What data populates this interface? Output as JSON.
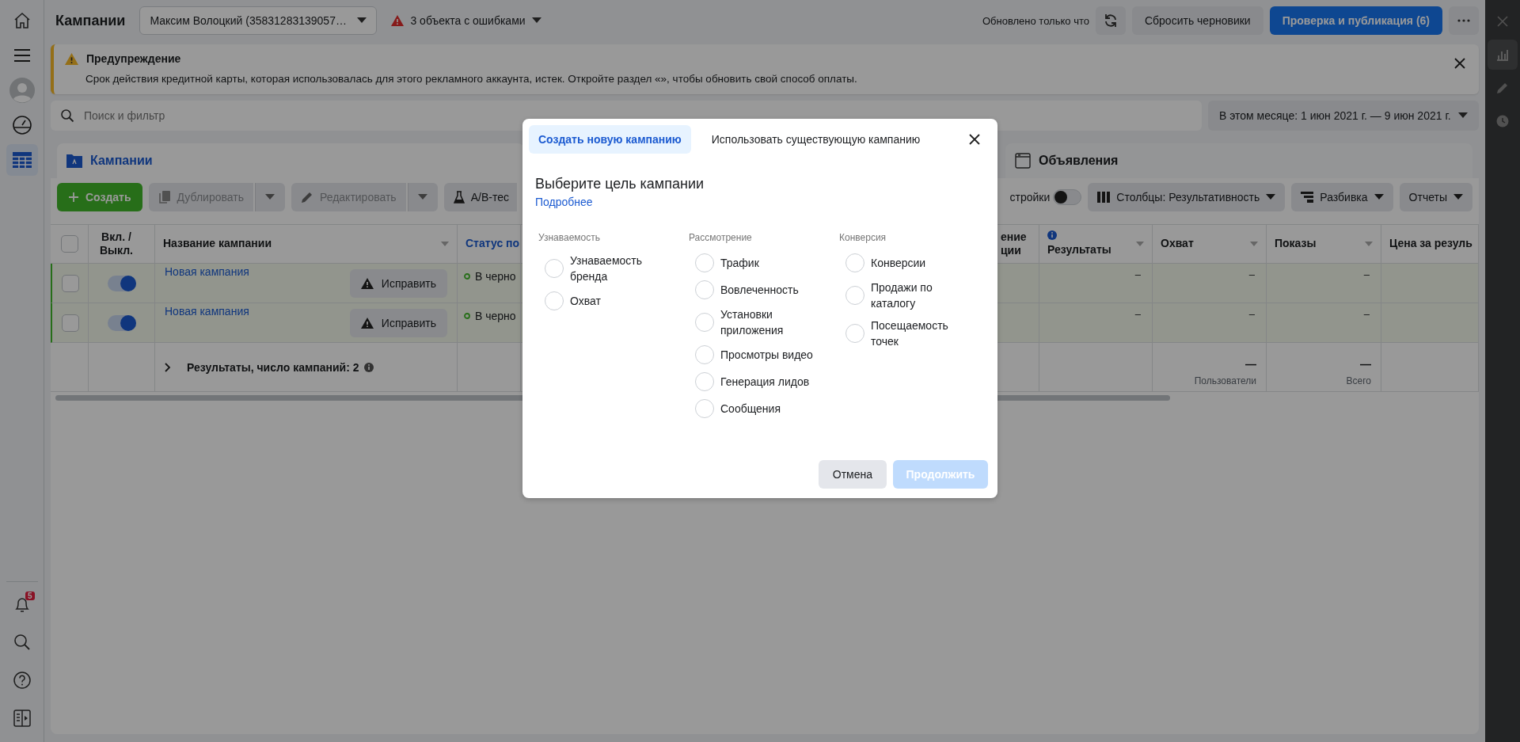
{
  "left_nav": {
    "items": [
      {
        "kind": "home",
        "selected": false
      },
      {
        "kind": "menu",
        "selected": false
      },
      {
        "kind": "avatar",
        "selected": false
      },
      {
        "kind": "gauge",
        "selected": false
      },
      {
        "kind": "table",
        "selected": true
      }
    ],
    "bottom_items": [
      {
        "kind": "bell",
        "badge": "5"
      },
      {
        "kind": "search"
      },
      {
        "kind": "help"
      },
      {
        "kind": "panel"
      }
    ]
  },
  "header": {
    "title": "Кампании",
    "account": "Максим Волоцкий (35831283139057…",
    "errors": "3 объекта с ошибками",
    "updated": "Обновлено только что",
    "reset": "Сбросить черновики",
    "publish": "Проверка и публикация (6)"
  },
  "warning": {
    "title": "Предупреждение",
    "text": "Срок действия кредитной карты, которая использовалась для этого рекламного аккаунта, истек. Откройте раздел «», чтобы обновить свой способ оплаты."
  },
  "search": {
    "placeholder": "Поиск и фильтр"
  },
  "date_range": "В этом месяце: 1 июн 2021 г. — 9 июн 2021 г.",
  "level_tabs": [
    {
      "label": "Кампании",
      "selected": true
    },
    {
      "label": "Объявления",
      "selected": false
    }
  ],
  "toolbar": {
    "create": "Создать",
    "duplicate": "Дублировать",
    "edit": "Редактировать",
    "ab_test": "A/B-тес",
    "settings_toggle": {
      "label": "стройки",
      "on": false
    },
    "columns": "Столбцы: Результативность",
    "breakdown": "Разбивка",
    "reports": "Отчеты"
  },
  "table": {
    "select_all_checked": false,
    "columns": [
      {
        "label": "Вкл. / Выкл."
      },
      {
        "label": "Название кампании"
      },
      {
        "label": "Статус по"
      },
      {
        "label": "ение ции"
      },
      {
        "label": "Результаты"
      },
      {
        "label": "Охват"
      },
      {
        "label": "Показы"
      },
      {
        "label": "Цена за резуль"
      }
    ],
    "rows": [
      {
        "checked": false,
        "on": true,
        "name": "Новая кампания",
        "fix": "Исправить",
        "status": "В черно",
        "results": "–",
        "reach": "–",
        "impressions": "–"
      },
      {
        "checked": false,
        "on": true,
        "name": "Новая кампания",
        "fix": "Исправить",
        "status": "В черно",
        "results": "–",
        "reach": "–",
        "impressions": "–"
      }
    ],
    "summary": {
      "label": "Результаты, число кампаний: 2",
      "reach": "—",
      "reach_note": "Пользователи",
      "impressions": "—",
      "impressions_note": "Всего"
    }
  },
  "right_panel": {
    "items": [
      {
        "kind": "chart",
        "selected": true
      },
      {
        "kind": "pencil",
        "selected": false
      },
      {
        "kind": "clock",
        "selected": false
      }
    ]
  },
  "dialog": {
    "tabs": [
      {
        "label": "Создать новую кампанию",
        "selected": true
      },
      {
        "label": "Использовать существующую кампанию",
        "selected": false
      }
    ],
    "heading": "Выберите цель кампании",
    "link": "Подробнее",
    "groups": [
      {
        "title": "Узнаваемость",
        "options": [
          {
            "label": "Узнаваемость бренда",
            "selected": false
          },
          {
            "label": "Охват",
            "selected": false
          }
        ]
      },
      {
        "title": "Рассмотрение",
        "options": [
          {
            "label": "Трафик",
            "selected": false
          },
          {
            "label": "Вовлеченность",
            "selected": false
          },
          {
            "label": "Установки приложения",
            "selected": false
          },
          {
            "label": "Просмотры видео",
            "selected": false
          },
          {
            "label": "Генерация лидов",
            "selected": false
          },
          {
            "label": "Сообщения",
            "selected": false
          }
        ]
      },
      {
        "title": "Конверсия",
        "options": [
          {
            "label": "Конверсии",
            "selected": false
          },
          {
            "label": "Продажи по каталогу",
            "selected": false
          },
          {
            "label": "Посещаемость точек",
            "selected": false
          }
        ]
      }
    ],
    "cancel": "Отмена",
    "continue": {
      "label": "Продолжить",
      "disabled": true
    }
  }
}
